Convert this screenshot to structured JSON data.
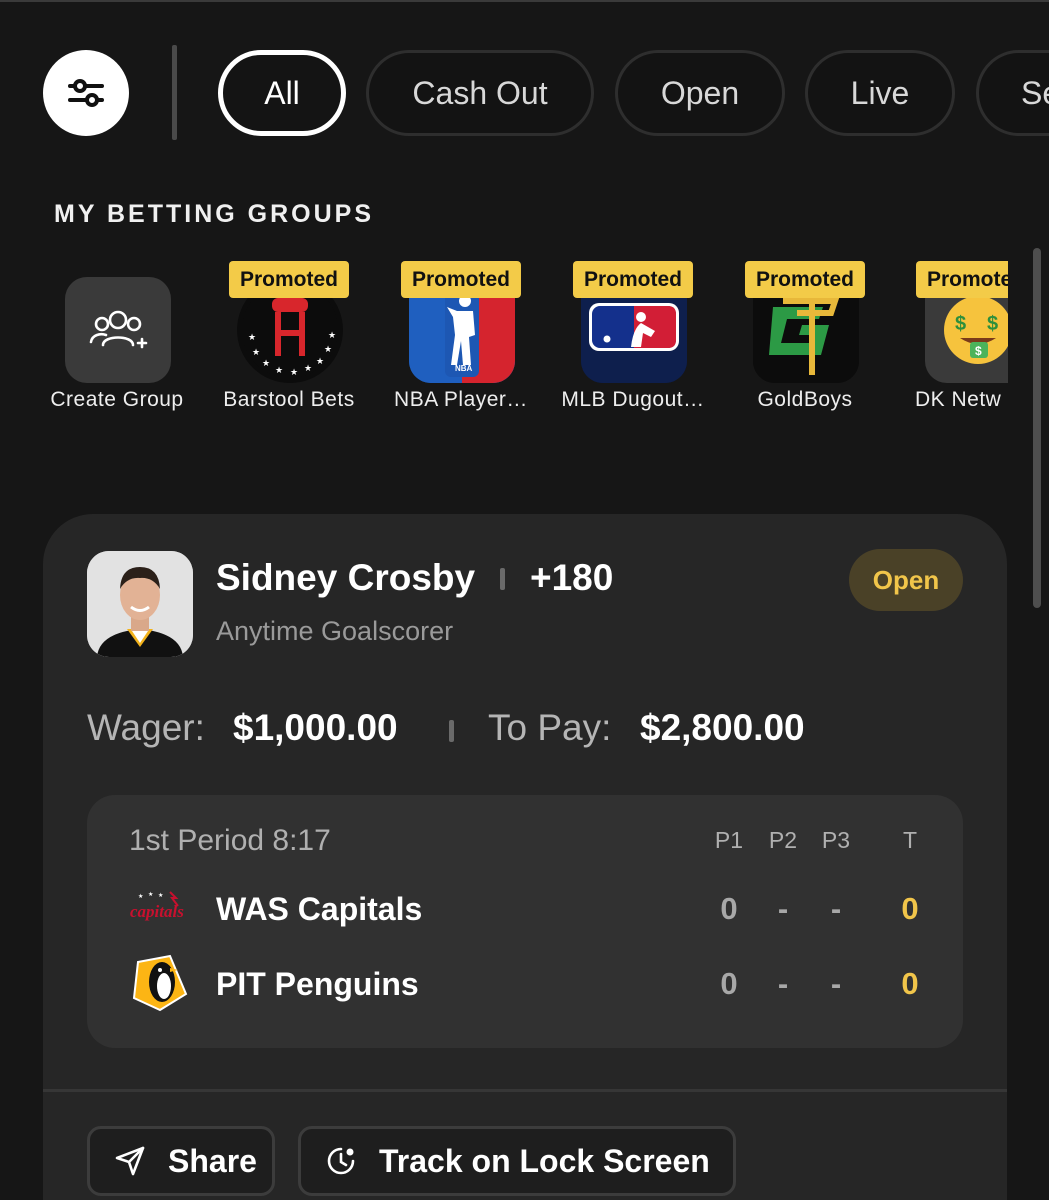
{
  "filters": {
    "chips": [
      "All",
      "Cash Out",
      "Open",
      "Live",
      "Se"
    ],
    "active": "All"
  },
  "groups": {
    "title": "MY BETTING GROUPS",
    "items": [
      {
        "label": "Create Group",
        "badge": "",
        "icon": "create-group-icon"
      },
      {
        "label": "Barstool Bets",
        "badge": "Promoted",
        "icon": "barstool-logo"
      },
      {
        "label": "NBA Player…",
        "badge": "Promoted",
        "icon": "nba-logo"
      },
      {
        "label": "MLB Dugout…",
        "badge": "Promoted",
        "icon": "mlb-logo"
      },
      {
        "label": "GoldBoys",
        "badge": "Promoted",
        "icon": "goldboys-logo"
      },
      {
        "label": "DK Netw",
        "badge": "Promote",
        "icon": "money-face-emoji"
      }
    ]
  },
  "bet": {
    "player": "Sidney Crosby",
    "odds": "+180",
    "market": "Anytime Goalscorer",
    "status": "Open",
    "wager_label": "Wager:",
    "wager": "$1,000.00",
    "to_pay_label": "To Pay:",
    "to_pay": "$2,800.00",
    "score": {
      "period": "1st Period 8:17",
      "columns": [
        "P1",
        "P2",
        "P3",
        "T"
      ],
      "teams": [
        {
          "name": "WAS Capitals",
          "scores": [
            "0",
            "-",
            "-",
            "0"
          ],
          "logo": "capitals-logo"
        },
        {
          "name": "PIT Penguins",
          "scores": [
            "0",
            "-",
            "-",
            "0"
          ],
          "logo": "penguins-logo"
        }
      ]
    },
    "actions": {
      "share": "Share",
      "track": "Track on Lock Screen"
    }
  },
  "colors": {
    "background": "#161616",
    "card": "#262626",
    "accent_yellow": "#f1c54a",
    "promo_badge": "#f3cb48"
  }
}
